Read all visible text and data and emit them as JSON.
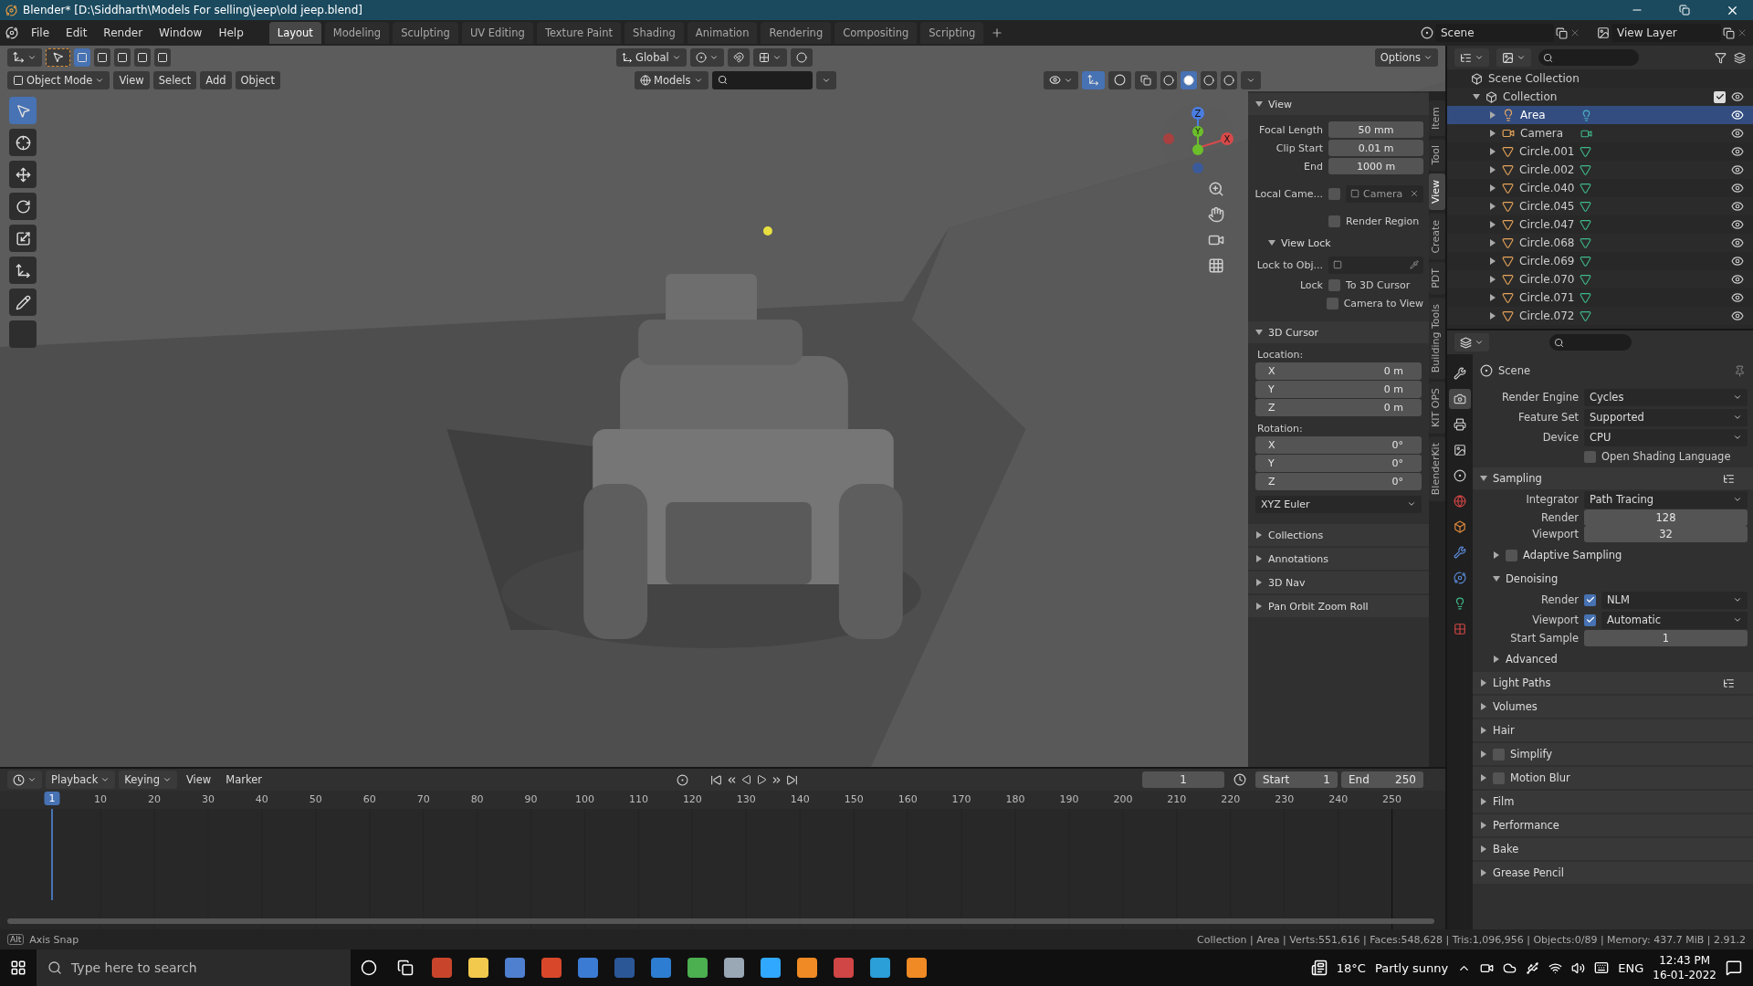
{
  "window": {
    "title": "Blender* [D:\\Siddharth\\Models For selling\\jeep\\old jeep.blend]"
  },
  "menu": [
    "File",
    "Edit",
    "Render",
    "Window",
    "Help"
  ],
  "workspaces": [
    {
      "label": "Layout",
      "selected": true
    },
    {
      "label": "Modeling",
      "selected": false
    },
    {
      "label": "Sculpting",
      "selected": false
    },
    {
      "label": "UV Editing",
      "selected": false
    },
    {
      "label": "Texture Paint",
      "selected": false
    },
    {
      "label": "Shading",
      "selected": false
    },
    {
      "label": "Animation",
      "selected": false
    },
    {
      "label": "Rendering",
      "selected": false
    },
    {
      "label": "Compositing",
      "selected": false
    },
    {
      "label": "Scripting",
      "selected": false
    }
  ],
  "scene": "Scene",
  "view_layer": "View Layer",
  "tool_header": {
    "orientation": "Global",
    "options": "Options"
  },
  "viewport_header": {
    "mode": "Object Mode",
    "menus": [
      "View",
      "Select",
      "Add",
      "Object"
    ],
    "collection": "Models"
  },
  "shading": [
    {
      "kind": "wireframe",
      "selected": false
    },
    {
      "kind": "solid",
      "selected": true
    },
    {
      "kind": "material",
      "selected": false
    },
    {
      "kind": "rendered",
      "selected": false
    }
  ],
  "tools": [
    {
      "kind": "select",
      "selected": true
    },
    {
      "kind": "cursor",
      "selected": false
    },
    {
      "kind": "move",
      "selected": false
    },
    {
      "kind": "rotate",
      "selected": false
    },
    {
      "kind": "scale",
      "selected": false
    },
    {
      "kind": "transform",
      "selected": false
    },
    {
      "kind": "annotate",
      "selected": false
    },
    {
      "kind": "measure",
      "selected": false
    }
  ],
  "gizmo": [
    "Z",
    "Y",
    "X"
  ],
  "sidebar_tabs": [
    {
      "label": "Item",
      "selected": false
    },
    {
      "label": "Tool",
      "selected": false
    },
    {
      "label": "View",
      "selected": true
    },
    {
      "label": "Create",
      "selected": false
    },
    {
      "label": "PDT",
      "selected": false
    },
    {
      "label": "Building Tools",
      "selected": false
    },
    {
      "label": "KIT OPS",
      "selected": false
    },
    {
      "label": "BlenderKit",
      "selected": false
    }
  ],
  "view_panel": {
    "title": "View",
    "fields": [
      {
        "label": "Focal Length",
        "value": "50 mm"
      },
      {
        "label": "Clip Start",
        "value": "0.01 m"
      },
      {
        "label": "End",
        "value": "1000 m"
      }
    ],
    "local_camera": {
      "label": "Local Came...",
      "checked": false,
      "value": "Camera"
    },
    "render_region": {
      "label": "Render Region",
      "checked": false
    }
  },
  "view_lock": {
    "title": "View Lock",
    "lock_to_object": "Lock to Obj...",
    "lock_label": "Lock",
    "options": [
      {
        "label": "To 3D Cursor",
        "checked": false
      },
      {
        "label": "Camera to View",
        "checked": false
      }
    ]
  },
  "cursor_panel": {
    "title": "3D Cursor",
    "location_label": "Location:",
    "location": [
      {
        "axis": "X",
        "value": "0 m"
      },
      {
        "axis": "Y",
        "value": "0 m"
      },
      {
        "axis": "Z",
        "value": "0 m"
      }
    ],
    "rotation_label": "Rotation:",
    "rotation": [
      {
        "axis": "X",
        "value": "0°"
      },
      {
        "axis": "Y",
        "value": "0°"
      },
      {
        "axis": "Z",
        "value": "0°"
      }
    ],
    "rotation_mode": "XYZ Euler"
  },
  "closed_panels": [
    "Collections",
    "Annotations",
    "3D Nav",
    "Pan Orbit Zoom Roll"
  ],
  "outliner": {
    "root": "Scene Collection",
    "collection": {
      "name": "Collection",
      "checked": true,
      "expanded": true,
      "children": [
        {
          "name": "Area",
          "kind": "light",
          "selected": true
        },
        {
          "name": "Camera",
          "kind": "camera",
          "selected": false
        },
        {
          "name": "Circle.001",
          "kind": "mesh",
          "selected": false
        },
        {
          "name": "Circle.002",
          "kind": "mesh",
          "selected": false
        },
        {
          "name": "Circle.040",
          "kind": "mesh",
          "selected": false
        },
        {
          "name": "Circle.045",
          "kind": "mesh",
          "selected": false
        },
        {
          "name": "Circle.047",
          "kind": "mesh",
          "selected": false
        },
        {
          "name": "Circle.068",
          "kind": "mesh",
          "selected": false
        },
        {
          "name": "Circle.069",
          "kind": "mesh",
          "selected": false
        },
        {
          "name": "Circle.070",
          "kind": "mesh",
          "selected": false
        },
        {
          "name": "Circle.071",
          "kind": "mesh",
          "selected": false
        },
        {
          "name": "Circle.072",
          "kind": "mesh",
          "selected": false
        }
      ]
    }
  },
  "property_tabs": [
    {
      "kind": "tool",
      "selected": false
    },
    {
      "kind": "render",
      "selected": true
    },
    {
      "kind": "output",
      "selected": false
    },
    {
      "kind": "view_layer",
      "selected": false
    },
    {
      "kind": "scene",
      "selected": false
    },
    {
      "kind": "world",
      "selected": false
    },
    {
      "kind": "object",
      "selected": false
    },
    {
      "kind": "modifier",
      "selected": false
    },
    {
      "kind": "physics",
      "selected": false
    },
    {
      "kind": "data",
      "selected": false
    },
    {
      "kind": "texture",
      "selected": false
    }
  ],
  "properties": {
    "context": "Scene",
    "items": [
      {
        "kind": "select",
        "label": "Render Engine",
        "value": "Cycles"
      },
      {
        "kind": "select",
        "label": "Feature Set",
        "value": "Supported"
      },
      {
        "kind": "select",
        "label": "Device",
        "value": "CPU"
      },
      {
        "kind": "check",
        "label": "Open Shading Language",
        "checked": false
      },
      {
        "kind": "panel",
        "label": "Sampling",
        "expanded": true
      },
      {
        "kind": "select",
        "label": "Integrator",
        "value": "Path Tracing"
      },
      {
        "kind": "number",
        "label": "Render",
        "value": "128"
      },
      {
        "kind": "number",
        "label": "Viewport",
        "value": "32"
      },
      {
        "kind": "subpanel",
        "label": "Adaptive Sampling",
        "expanded": false,
        "checked": false
      },
      {
        "kind": "subpanel",
        "label": "Denoising",
        "expanded": true
      },
      {
        "kind": "check_select",
        "label": "Render",
        "checked": true,
        "value": "NLM"
      },
      {
        "kind": "check_select",
        "label": "Viewport",
        "checked": true,
        "value": "Automatic"
      },
      {
        "kind": "number",
        "label": "Start Sample",
        "value": "1"
      },
      {
        "kind": "subpanel",
        "label": "Advanced",
        "expanded": false
      },
      {
        "kind": "panel",
        "label": "Light Paths",
        "expanded": false
      },
      {
        "kind": "panel",
        "label": "Volumes",
        "expanded": false
      },
      {
        "kind": "panel",
        "label": "Hair",
        "expanded": false
      },
      {
        "kind": "panel",
        "label": "Simplify",
        "expanded": false,
        "checked": false
      },
      {
        "kind": "panel",
        "label": "Motion Blur",
        "expanded": false,
        "checked": false
      },
      {
        "kind": "panel",
        "label": "Film",
        "expanded": false
      },
      {
        "kind": "panel",
        "label": "Performance",
        "expanded": false
      },
      {
        "kind": "panel",
        "label": "Bake",
        "expanded": false
      },
      {
        "kind": "panel",
        "label": "Grease Pencil",
        "expanded": false
      }
    ]
  },
  "timeline": {
    "menus": [
      "Playback",
      "Keying",
      "View",
      "Marker"
    ],
    "current_frame": "1",
    "start_label": "Start",
    "start": "1",
    "end_label": "End",
    "end": "250",
    "marker": "1",
    "ticks": [
      "10",
      "20",
      "30",
      "40",
      "50",
      "60",
      "70",
      "80",
      "90",
      "100",
      "110",
      "120",
      "130",
      "140",
      "150",
      "160",
      "170",
      "180",
      "190",
      "200",
      "210",
      "220",
      "230",
      "240",
      "250"
    ]
  },
  "status_bar": {
    "key": "Alt",
    "hint": "Axis Snap",
    "stats": "Collection | Area | Verts:551,616 | Faces:548,628 | Tris:1,096,956 | Objects:0/89 | Memory: 437.7 MiB | 2.91.2"
  },
  "taskbar": {
    "search_placeholder": "Type here to search",
    "temperature": "18°C",
    "weather": "Partly sunny",
    "language": "ENG",
    "time": "12:43 PM",
    "date": "16-01-2022"
  }
}
